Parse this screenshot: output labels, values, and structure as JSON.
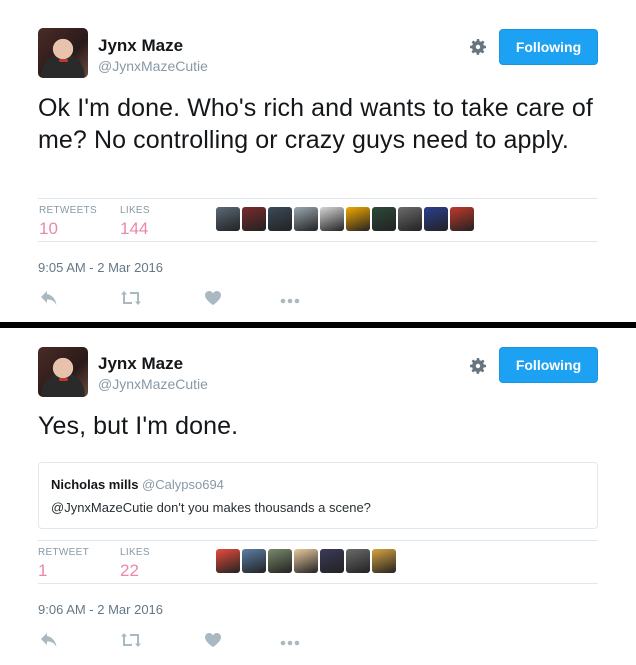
{
  "tweets": [
    {
      "display_name": "Jynx Maze",
      "handle": "@JynxMazeCutie",
      "follow_label": "Following",
      "text": "Ok I'm done. Who's rich and wants to take care of me? No controlling or crazy guys need to apply.",
      "stats": {
        "retweets_label": "RETWEETS",
        "retweets_value": "10",
        "likes_label": "LIKES",
        "likes_value": "144"
      },
      "liker_colors": [
        "#5a6a78",
        "#7a2b2b",
        "#3b4a5a",
        "#9aa7b0",
        "#d6d6d6",
        "#f2a900",
        "#2c4a3a",
        "#6b6b6b",
        "#2a3f8f",
        "#c0392b"
      ],
      "timestamp": "9:05 AM - 2 Mar 2016",
      "icons": {
        "reply": "reply-icon",
        "retweet": "retweet-icon",
        "like": "heart-icon",
        "more": "more-icon",
        "settings": "gear-icon"
      }
    },
    {
      "display_name": "Jynx Maze",
      "handle": "@JynxMazeCutie",
      "follow_label": "Following",
      "text": "Yes, but I'm done.",
      "quote": {
        "name": "Nicholas mills",
        "handle": "@Calypso694",
        "text": "@JynxMazeCutie don't you makes thousands a scene?"
      },
      "stats": {
        "retweets_label": "RETWEET",
        "retweets_value": "1",
        "likes_label": "LIKES",
        "likes_value": "22"
      },
      "liker_colors": [
        "#e74c3c",
        "#5b7fa6",
        "#7a8a6a",
        "#e8c9a0",
        "#3a3a5a",
        "#6a6a6a",
        "#d9a441"
      ],
      "timestamp": "9:06 AM - 2 Mar 2016",
      "icons": {
        "reply": "reply-icon",
        "retweet": "retweet-icon",
        "like": "heart-icon",
        "more": "more-icon",
        "settings": "gear-icon"
      }
    }
  ]
}
